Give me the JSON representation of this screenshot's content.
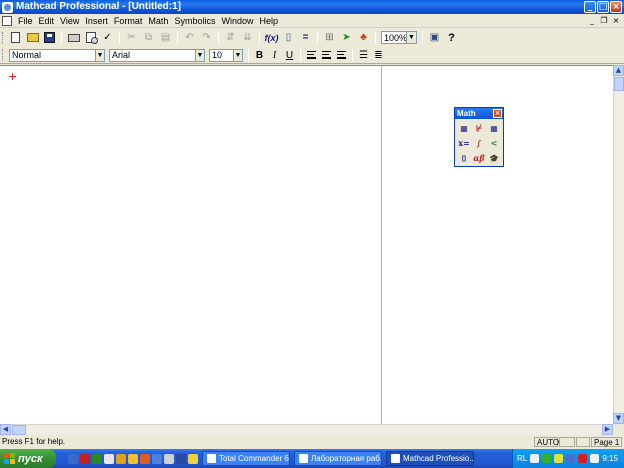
{
  "window": {
    "title": "Mathcad Professional - [Untitled:1]",
    "controls": {
      "minimize": "_",
      "maximize": "□",
      "close": "×"
    }
  },
  "menubar": {
    "items": [
      "File",
      "Edit",
      "View",
      "Insert",
      "Format",
      "Math",
      "Symbolics",
      "Window",
      "Help"
    ],
    "doc_controls": {
      "minimize": "_",
      "restore": "❐",
      "close": "×"
    }
  },
  "standard_toolbar": {
    "zoom": "100%",
    "help_glyph": "?"
  },
  "formatting_toolbar": {
    "style": "Normal",
    "font": "Arial",
    "size": "10",
    "bold": "B",
    "italic": "I",
    "underline": "U"
  },
  "worksheet": {
    "cursor_glyph": "+"
  },
  "math_palette": {
    "title": "Math",
    "buttons": [
      {
        "glyph": "▦",
        "icon": "calculator-icon"
      },
      {
        "glyph": "⊬",
        "icon": "graph-icon"
      },
      {
        "glyph": "▦",
        "icon": "matrix-icon"
      },
      {
        "glyph": "x=",
        "icon": "evaluation-icon"
      },
      {
        "glyph": "∫",
        "icon": "calculus-icon"
      },
      {
        "glyph": "<",
        "icon": "boolean-icon"
      },
      {
        "glyph": "⌷",
        "icon": "programming-icon"
      },
      {
        "glyph": "αβ",
        "icon": "greek-icon"
      },
      {
        "glyph": "🎓",
        "icon": "symbolic-icon"
      }
    ]
  },
  "statusbar": {
    "help_text": "Press F1 for help.",
    "calc_mode": "AUTO",
    "page": "Page 1"
  },
  "taskbar": {
    "start_label": "пуск",
    "tasks": [
      {
        "label": "Total Commander 6....",
        "active": false
      },
      {
        "label": "Лабораторная раб...",
        "active": false
      },
      {
        "label": "Mathcad Professio...",
        "active": true
      }
    ],
    "language": "RL",
    "clock": "9:15"
  },
  "colors": {
    "titlebar": "#0B55D6",
    "taskbar": "#2460DC",
    "start": "#2F8C2E",
    "cursor": "#EE0000"
  }
}
